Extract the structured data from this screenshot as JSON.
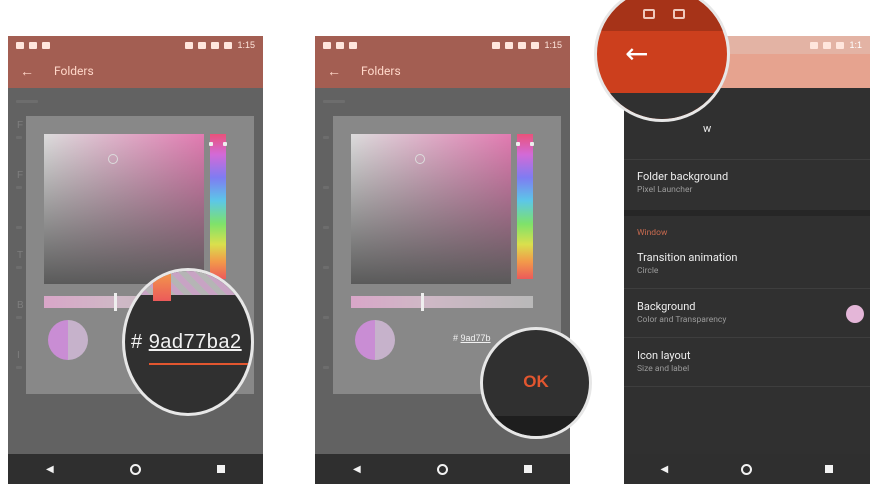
{
  "status": {
    "time": "1:15",
    "time_cropped": "1:1"
  },
  "app_bar": {
    "back_symbol": "←",
    "title": "Folders"
  },
  "dim_background": {
    "letters": [
      "F",
      "F",
      "T",
      "B",
      "I"
    ],
    "line_count": 12
  },
  "color_picker": {
    "hex_prefix": "#",
    "hex_value": "9ad77ba2",
    "hex_partial": "9ad77b",
    "preview_color": "#c98dd4",
    "ok_label": "OK"
  },
  "settings": {
    "partial_row_title": "w",
    "rows_top": [
      {
        "title": "Folder background",
        "subtitle": "Pixel Launcher"
      }
    ],
    "section_window": "Window",
    "rows_window": [
      {
        "title": "Transition animation",
        "subtitle": "Circle"
      },
      {
        "title": "Background",
        "subtitle": "Color and Transparency"
      },
      {
        "title": "Icon layout",
        "subtitle": "Size and label"
      }
    ],
    "background_swatch_color": "#e4b6d8"
  },
  "nav": {
    "back": "◀",
    "home": "home",
    "recents": "recents"
  },
  "colors": {
    "accent_red": "#e2562f",
    "dim_overlay": "#626262",
    "appbar_dim": "#a35e52",
    "appbar_light": "#e6a38f"
  }
}
